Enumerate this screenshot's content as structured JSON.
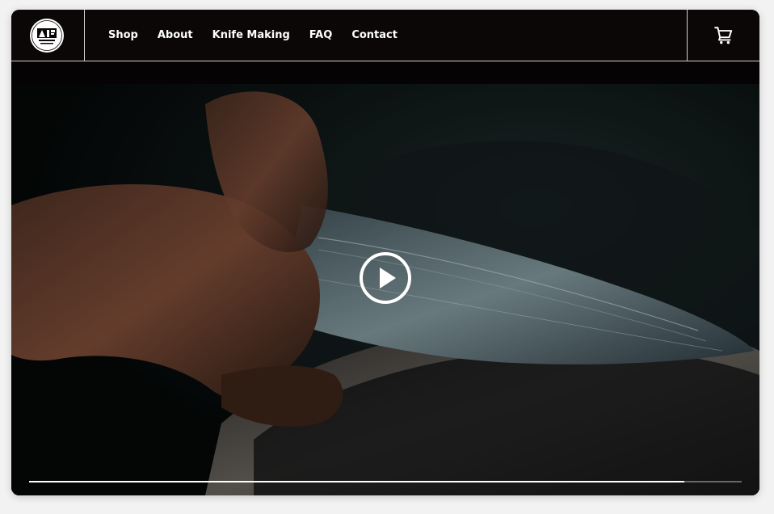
{
  "header": {
    "logo_text": "TAKEFU Knife Village",
    "nav": [
      {
        "label": "Shop"
      },
      {
        "label": "About"
      },
      {
        "label": "Knife Making"
      },
      {
        "label": "FAQ"
      },
      {
        "label": "Contact"
      }
    ],
    "cart_icon": "cart-icon"
  },
  "video": {
    "play_icon": "play-icon",
    "progress_fraction": 0.92
  },
  "colors": {
    "background": "#0b0706",
    "divider": "#cfcfcf",
    "text": "#ffffff"
  }
}
